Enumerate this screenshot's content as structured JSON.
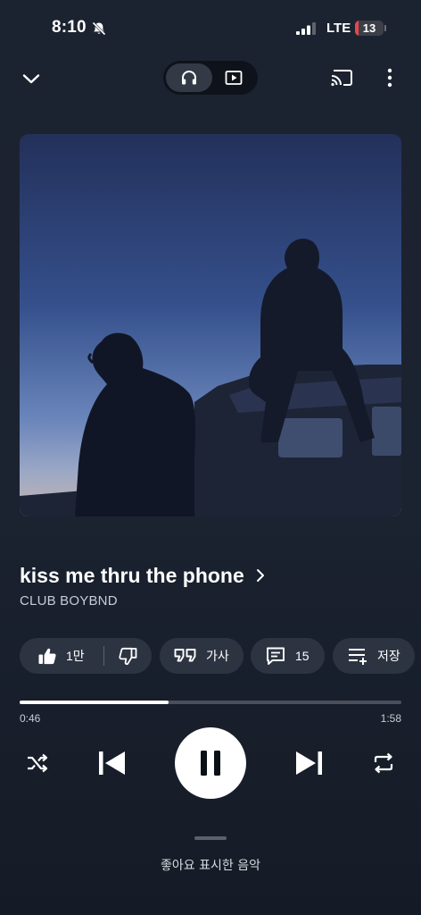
{
  "status_bar": {
    "time": "8:10",
    "network": "LTE",
    "battery_level": "13",
    "battery_fraction": 0.13,
    "icons": [
      "bell-slash-icon",
      "signal-icon"
    ]
  },
  "top_bar": {
    "icons": [
      "chevron-down-icon",
      "headphones-icon",
      "video-icon",
      "cast-icon",
      "more-vertical-icon"
    ]
  },
  "song": {
    "title": "kiss me thru the phone",
    "artist": "CLUB BOYBND"
  },
  "actions": {
    "like_count": "1만",
    "lyrics_label": "가사",
    "comments_count": "15",
    "save_label": "저장"
  },
  "player": {
    "elapsed": "0:46",
    "total": "1:58",
    "progress_fraction": 0.39
  },
  "bottom": {
    "liked_music_label": "좋아요 표시한 음악"
  },
  "colors": {
    "background": "#1b2230",
    "chip": "#2d3441",
    "battery_low": "#e5484d"
  }
}
